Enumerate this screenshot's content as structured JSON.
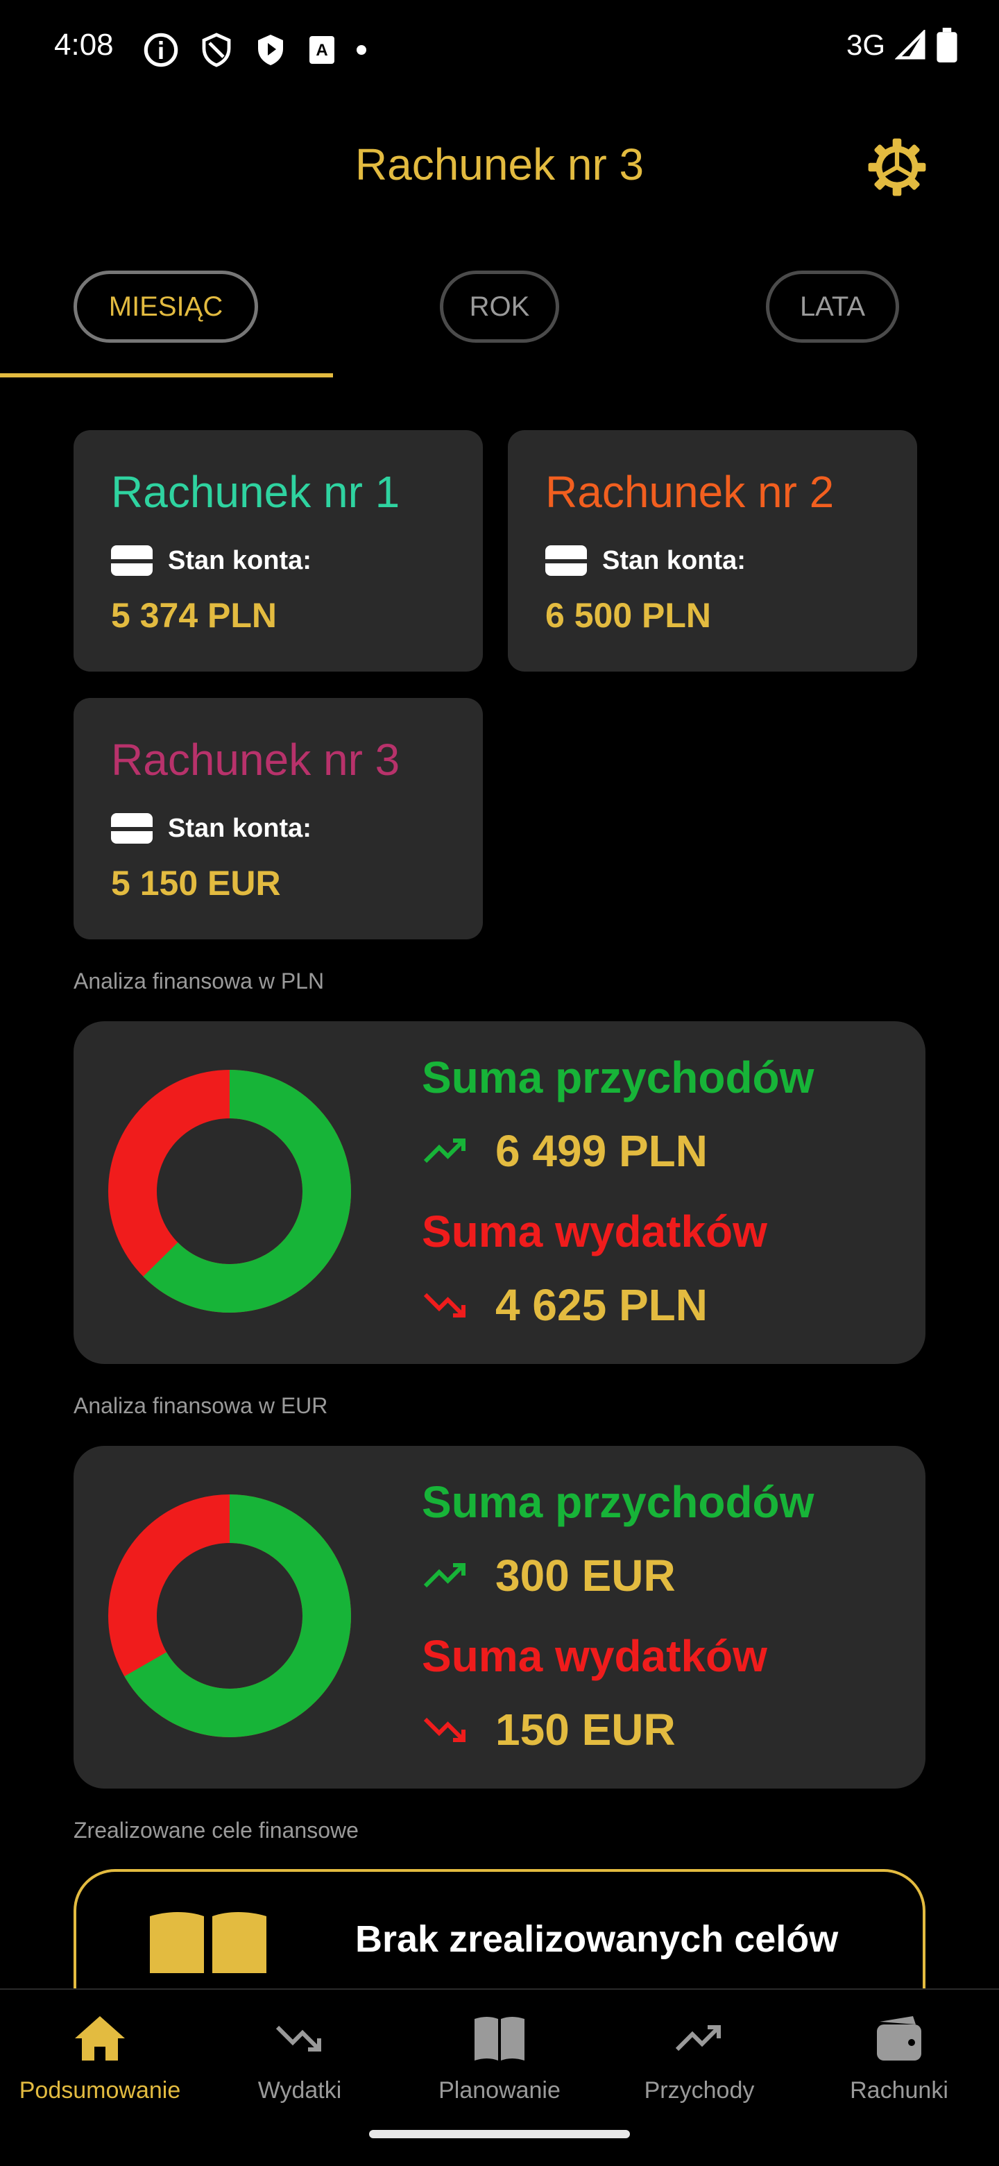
{
  "status_bar": {
    "time": "4:08",
    "network": "3G",
    "icons": [
      "info-icon",
      "shield-icon",
      "play-shield-icon",
      "a-badge-icon",
      "dot-icon"
    ],
    "right_icons": [
      "signal-icon",
      "battery-icon"
    ]
  },
  "header": {
    "title": "Rachunek nr 3",
    "settings_icon": "gear-icon"
  },
  "tabs": [
    {
      "label": "MIESIĄC",
      "active": true
    },
    {
      "label": "ROK",
      "active": false
    },
    {
      "label": "LATA",
      "active": false
    }
  ],
  "accounts": [
    {
      "name": "Rachunek nr 1",
      "label": "Stan konta:",
      "balance": "5 374 PLN",
      "color": "#2fd3a0"
    },
    {
      "name": "Rachunek nr 2",
      "label": "Stan konta:",
      "balance": "6 500 PLN",
      "color": "#f25f1f"
    },
    {
      "name": "Rachunek nr 3",
      "label": "Stan konta:",
      "balance": "5 150 EUR",
      "color": "#b8326b"
    }
  ],
  "analysis": [
    {
      "section_label": "Analiza finansowa w PLN",
      "income_title": "Suma przychodów",
      "income_amount": "6 499 PLN",
      "expense_title": "Suma wydatków",
      "expense_amount": "4 625 PLN",
      "income_color": "#17b438",
      "expense_color": "#f01c1c"
    },
    {
      "section_label": "Analiza finansowa w EUR",
      "income_title": "Suma przychodów",
      "income_amount": "300 EUR",
      "expense_title": "Suma wydatków",
      "expense_amount": "150 EUR",
      "income_color": "#17b438",
      "expense_color": "#f01c1c"
    }
  ],
  "goals": {
    "section_label": "Zrealizowane cele finansowe",
    "empty_text": "Brak zrealizowanych celów"
  },
  "bottom_nav": [
    {
      "label": "Podsumowanie",
      "icon": "home-icon",
      "active": true
    },
    {
      "label": "Wydatki",
      "icon": "trending-down-icon",
      "active": false
    },
    {
      "label": "Planowanie",
      "icon": "book-icon",
      "active": false
    },
    {
      "label": "Przychody",
      "icon": "trending-up-icon",
      "active": false
    },
    {
      "label": "Rachunki",
      "icon": "wallet-icon",
      "active": false
    }
  ],
  "colors": {
    "accent": "#e3bb40",
    "card": "#2a2a2a",
    "background": "#000000"
  }
}
